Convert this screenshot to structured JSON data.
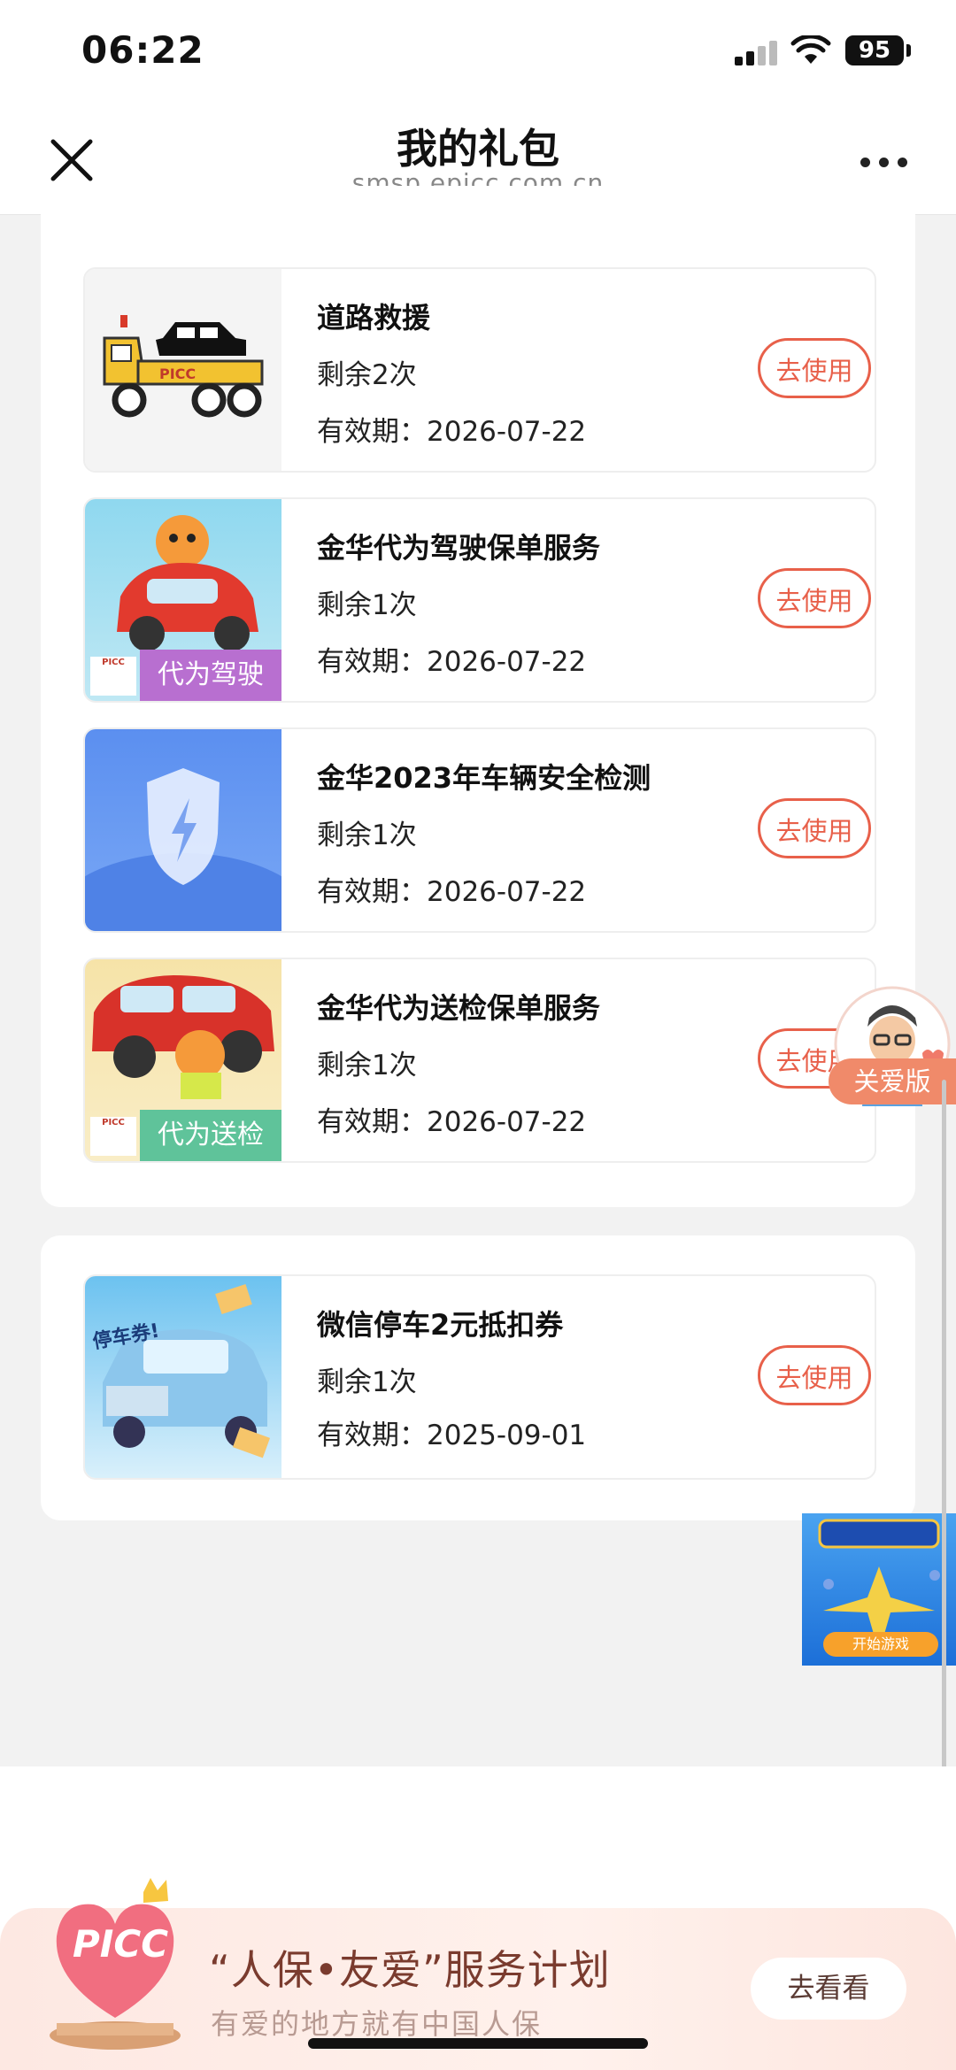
{
  "status": {
    "time": "06:22",
    "battery": "95"
  },
  "nav": {
    "title": "我的礼包",
    "domain": "smsp.epicc.com.cn"
  },
  "gifts": [
    {
      "title": "道路救援",
      "remaining": "剩余2次",
      "expiry": "有效期：2026-07-22",
      "action": "去使用",
      "thumb_text": "PICC"
    },
    {
      "title": "金华代为驾驶保单服务",
      "remaining": "剩余1次",
      "expiry": "有效期：2026-07-22",
      "action": "去使用",
      "tag": "代为驾驶"
    },
    {
      "title": "金华2023年车辆安全检测",
      "remaining": "剩余1次",
      "expiry": "有效期：2026-07-22",
      "action": "去使用"
    },
    {
      "title": "金华代为送检保单服务",
      "remaining": "剩余1次",
      "expiry": "有效期：2026-07-22",
      "action": "去使用",
      "tag": "代为送检"
    },
    {
      "title": "微信停车2元抵扣券",
      "remaining": "剩余1次",
      "expiry": "有效期：2025-09-01",
      "action": "去使用",
      "thumb_text": "停车券!"
    }
  ],
  "care_mode": {
    "label": "关爱版"
  },
  "game": {
    "button": "开始游戏"
  },
  "banner": {
    "logo_text": "PICC",
    "title": "“人保•友爱”服务计划",
    "subtitle": "有爱的地方就有中国人保",
    "button": "去看看"
  },
  "colors": {
    "accent": "#e8604a",
    "page_bg": "#f2f2f2",
    "tag_purple": "#b86fd0",
    "tag_green": "#5fc39a"
  }
}
